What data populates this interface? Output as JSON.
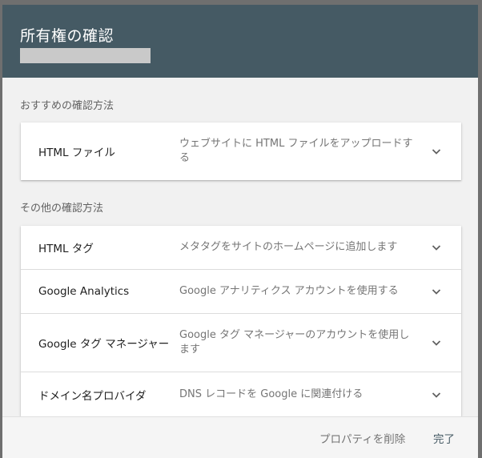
{
  "dialog": {
    "title": "所有権の確認"
  },
  "recommended": {
    "label": "おすすめの確認方法",
    "methods": [
      {
        "name": "HTML ファイル",
        "description": "ウェブサイトに HTML ファイルをアップロードする"
      }
    ]
  },
  "other": {
    "label": "その他の確認方法",
    "methods": [
      {
        "name": "HTML タグ",
        "description": "メタタグをサイトのホームページに追加します"
      },
      {
        "name": "Google Analytics",
        "description": "Google アナリティクス アカウントを使用する"
      },
      {
        "name": "Google タグ マネージャー",
        "description": "Google タグ マネージャーのアカウントを使用します"
      },
      {
        "name": "ドメイン名プロバイダ",
        "description": "DNS レコードを Google に関連付ける"
      }
    ]
  },
  "footer": {
    "delete_label": "プロパティを削除",
    "done_label": "完了"
  },
  "icons": {
    "expand": "chevron-down-icon"
  },
  "colors": {
    "header": "#455a64",
    "background": "#f1f1f1"
  }
}
